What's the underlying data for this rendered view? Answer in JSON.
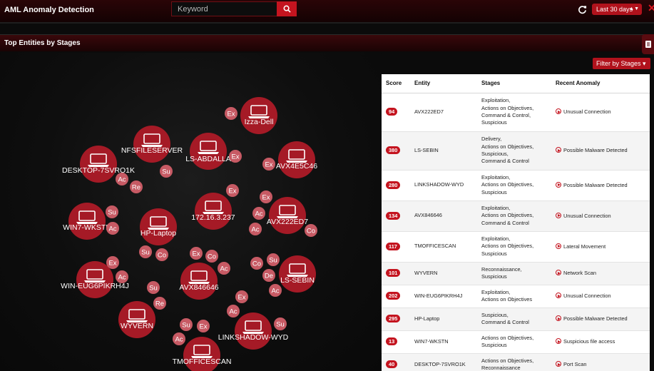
{
  "app": {
    "title": "AML Anomaly Detection"
  },
  "search": {
    "placeholder": "Keyword"
  },
  "time_range": {
    "label": "Last 30 days"
  },
  "panel": {
    "title": "Top Entities by Stages",
    "filter_label": "Filter by Stages"
  },
  "colors": {
    "accent": "#c4141f",
    "node": "#a51a26",
    "badge": "#c75a64",
    "header": "#2a0507"
  },
  "graph": {
    "nodes": [
      {
        "label": "Izza-Dell",
        "badges": [
          "Ex"
        ]
      },
      {
        "label": "NFSFILESERVER",
        "badges": []
      },
      {
        "label": "LS-ABDALLA",
        "badges": [
          "Ex"
        ]
      },
      {
        "label": "AVX4E5C46",
        "badges": [
          "Ex"
        ]
      },
      {
        "label": "DESKTOP-7SVRO1K",
        "badges": [
          "Su",
          "Ac",
          "Re"
        ]
      },
      {
        "label": "172.16.3.237",
        "badges": [
          "Ex",
          "Ac"
        ]
      },
      {
        "label": "AVX222ED7",
        "badges": [
          "Ex",
          "Ac",
          "Co",
          "Su"
        ]
      },
      {
        "label": "WIN7-WKSTN",
        "badges": [
          "Su",
          "Ac"
        ]
      },
      {
        "label": "HP-Laptop",
        "badges": [
          "Su",
          "Co"
        ]
      },
      {
        "label": "AVX846646",
        "badges": [
          "Ex",
          "Co",
          "Ac"
        ]
      },
      {
        "label": "LS-SEBIN",
        "badges": [
          "Co",
          "Su",
          "De",
          "Ac"
        ]
      },
      {
        "label": "WIN-EUG6PIKRH4J",
        "badges": [
          "Ex",
          "Ac"
        ]
      },
      {
        "label": "WYVERN",
        "badges": [
          "Su",
          "Re"
        ]
      },
      {
        "label": "LINKSHADOW-WYD",
        "badges": [
          "Ex",
          "Ac",
          "Su"
        ]
      },
      {
        "label": "TMOFFICESCAN",
        "badges": [
          "Su",
          "Ex",
          "Ac"
        ]
      }
    ]
  },
  "table": {
    "headers": {
      "score": "Score",
      "entity": "Entity",
      "stages": "Stages",
      "anomaly": "Recent Anomaly"
    },
    "rows": [
      {
        "score": "94",
        "entity": "AVX222ED7",
        "stages": [
          "Exploitation,",
          "Actions on Objectives,",
          "Command & Control,",
          "Suspicious"
        ],
        "anomaly": "Unusual Connection"
      },
      {
        "score": "380",
        "entity": "LS-SEBIN",
        "stages": [
          "Delivery,",
          "Actions on Objectives,",
          "Suspicious,",
          "Command & Control"
        ],
        "anomaly": "Possible Malware Detected"
      },
      {
        "score": "280",
        "entity": "LINKSHADOW-WYD",
        "stages": [
          "Exploitation,",
          "Actions on Objectives,",
          "Suspicious"
        ],
        "anomaly": "Possible Malware Detected"
      },
      {
        "score": "134",
        "entity": "AVX846646",
        "stages": [
          "Exploitation,",
          "Actions on Objectives,",
          "Command & Control"
        ],
        "anomaly": "Unusual Connection"
      },
      {
        "score": "117",
        "entity": "TMOFFICESCAN",
        "stages": [
          "Exploitation,",
          "Actions on Objectives,",
          "Suspicious"
        ],
        "anomaly": "Lateral Movement"
      },
      {
        "score": "101",
        "entity": "WYVERN",
        "stages": [
          "Reconnaissance,",
          "Suspicious"
        ],
        "anomaly": "Network Scan"
      },
      {
        "score": "202",
        "entity": "WIN-EUG6PIKRH4J",
        "stages": [
          "Exploitation,",
          "Actions on Objectives"
        ],
        "anomaly": "Unusual Connection"
      },
      {
        "score": "295",
        "entity": "HP-Laptop",
        "stages": [
          "Suspicious,",
          "Command & Control"
        ],
        "anomaly": "Possible Malware Detected"
      },
      {
        "score": "13",
        "entity": "WIN7-WKSTN",
        "stages": [
          "Actions on Objectives,",
          "Suspicious"
        ],
        "anomaly": "Suspicious file access"
      },
      {
        "score": "40",
        "entity": "DESKTOP-7SVRO1K",
        "stages": [
          "Actions on Objectives,",
          "Reconnaissance"
        ],
        "anomaly": "Port Scan"
      }
    ]
  }
}
